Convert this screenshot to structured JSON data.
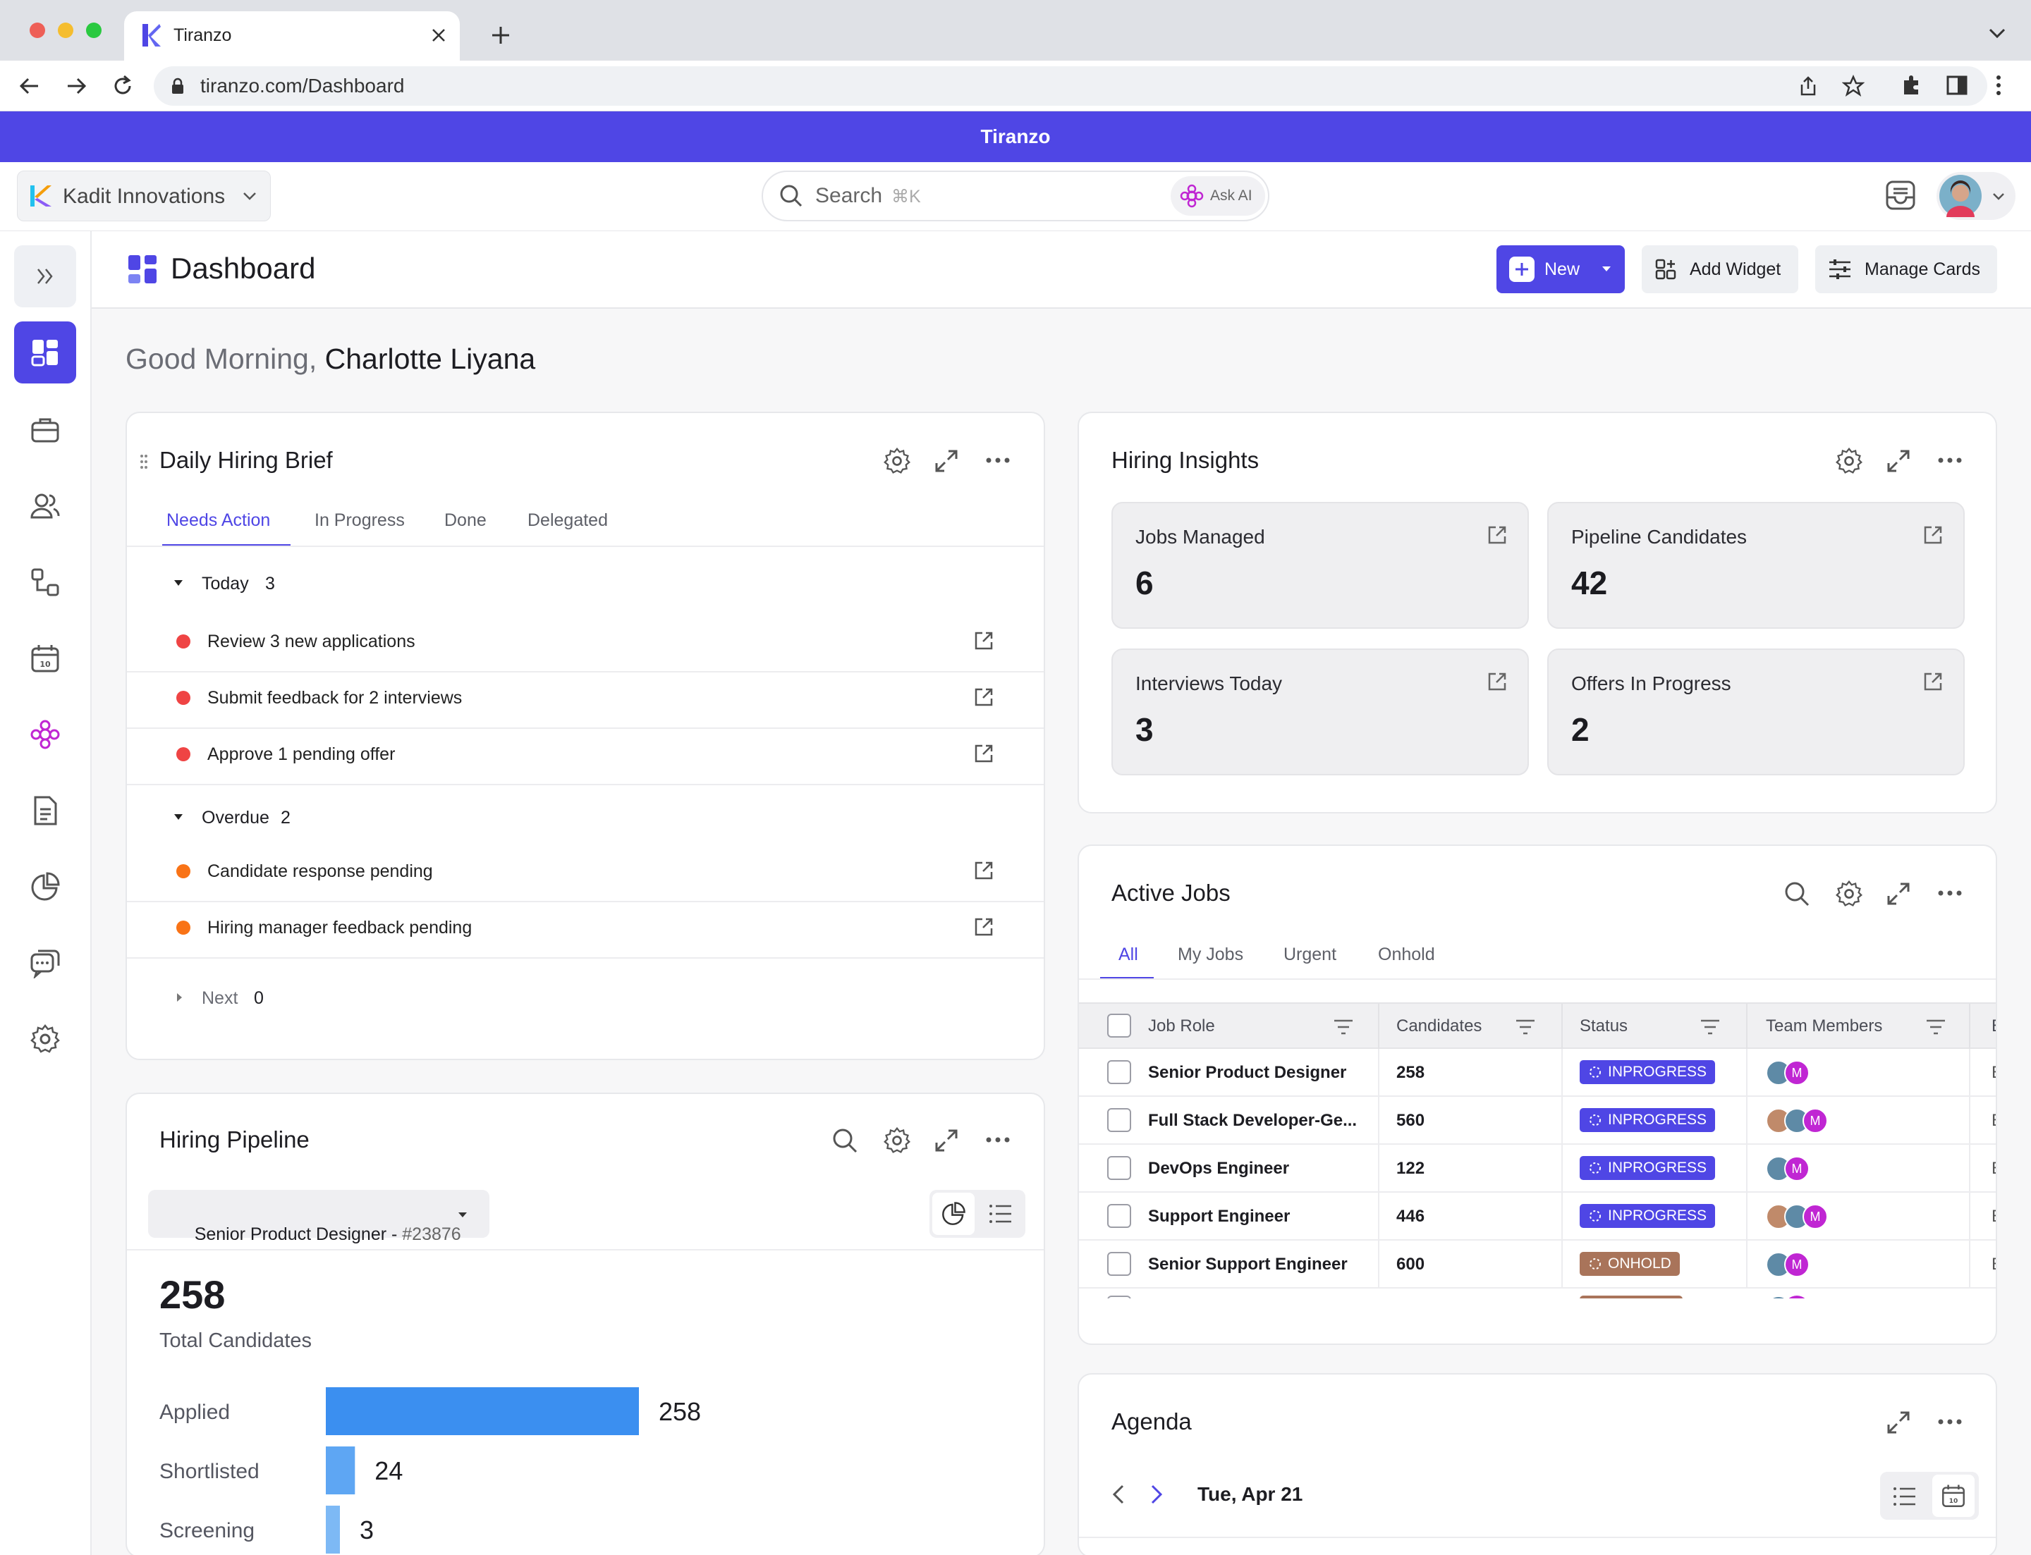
{
  "browser": {
    "tab_title": "Tiranzo",
    "url": "tiranzo.com/Dashboard"
  },
  "banner": {
    "title": "Tiranzo"
  },
  "header": {
    "org_name": "Kadit Innovations",
    "search_placeholder": "Search",
    "search_shortcut": "⌘K",
    "ask_ai_label": "Ask AI"
  },
  "page": {
    "title": "Dashboard",
    "new_label": "New",
    "add_widget_label": "Add Widget",
    "manage_cards_label": "Manage Cards",
    "greeting_prefix": "Good Morning,",
    "user_name": "Charlotte Liyana"
  },
  "brief": {
    "title": "Daily Hiring Brief",
    "tabs": [
      "Needs Action",
      "In Progress",
      "Done",
      "Delegated"
    ],
    "groups": [
      {
        "label": "Today",
        "count": "3"
      },
      {
        "label": "Overdue",
        "count": "2"
      },
      {
        "label": "Next",
        "count": "0"
      }
    ],
    "items": [
      "Review 3 new applications",
      "Submit feedback for 2 interviews",
      "Approve 1 pending offer",
      "Candidate response pending",
      "Hiring manager feedback pending"
    ],
    "dot_red": "#ef4444",
    "dot_orange": "#f97316"
  },
  "insights": {
    "title": "Hiring Insights",
    "stats": [
      {
        "label": "Jobs Managed",
        "value": "6"
      },
      {
        "label": "Pipeline Candidates",
        "value": "42"
      },
      {
        "label": "Interviews Today",
        "value": "3"
      },
      {
        "label": "Offers In Progress",
        "value": "2"
      }
    ]
  },
  "jobs": {
    "title": "Active Jobs",
    "tabs": [
      "All",
      "My Jobs",
      "Urgent",
      "Onhold"
    ],
    "columns": [
      "Job Role",
      "Candidates",
      "Status",
      "Team Members",
      "E"
    ],
    "rows": [
      {
        "role": "Senior Product Designer",
        "candidates": "258",
        "status": "INPROGRESS",
        "extra": "E"
      },
      {
        "role": "Full Stack Developer-Ge...",
        "candidates": "560",
        "status": "INPROGRESS",
        "extra": "E"
      },
      {
        "role": "DevOps Engineer",
        "candidates": "122",
        "status": "INPROGRESS",
        "extra": "E"
      },
      {
        "role": "Support Engineer",
        "candidates": "446",
        "status": "INPROGRESS",
        "extra": "E"
      },
      {
        "role": "Senior Support Engineer",
        "candidates": "600",
        "status": "ONHOLD",
        "extra": "E"
      }
    ],
    "avatar_initial": "M"
  },
  "pipeline": {
    "title": "Hiring Pipeline",
    "job_select": "Senior Product Designer - ",
    "job_id": "#23876",
    "total": "258",
    "total_label": "Total Candidates"
  },
  "chart_data": {
    "type": "bar",
    "orientation": "horizontal",
    "categories": [
      "Applied",
      "Shortlisted",
      "Screening"
    ],
    "values": [
      258,
      24,
      3
    ],
    "colors": [
      "#3b8ff0",
      "#5ea6f3",
      "#7db9f5"
    ]
  },
  "agenda": {
    "title": "Agenda",
    "date": "Tue, Apr 21"
  }
}
